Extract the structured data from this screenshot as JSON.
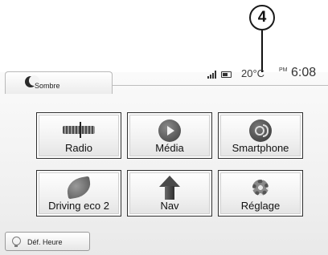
{
  "callout": {
    "number": "4"
  },
  "header": {
    "mode_label": "Sombre",
    "temperature": "20°C",
    "ampm": "PM",
    "time": "6:08"
  },
  "tiles": [
    {
      "label": "Radio",
      "icon": "radio-icon"
    },
    {
      "label": "Média",
      "icon": "media-icon"
    },
    {
      "label": "Smartphone",
      "icon": "smartphone-icon"
    },
    {
      "label": "Driving eco 2",
      "icon": "eco-leaf-icon"
    },
    {
      "label": "Nav",
      "icon": "navigation-arrow-icon"
    },
    {
      "label": "Réglage",
      "icon": "gear-icon"
    }
  ],
  "footer": {
    "set_time_label": "Déf. Heure",
    "icon": "bulb-icon"
  }
}
